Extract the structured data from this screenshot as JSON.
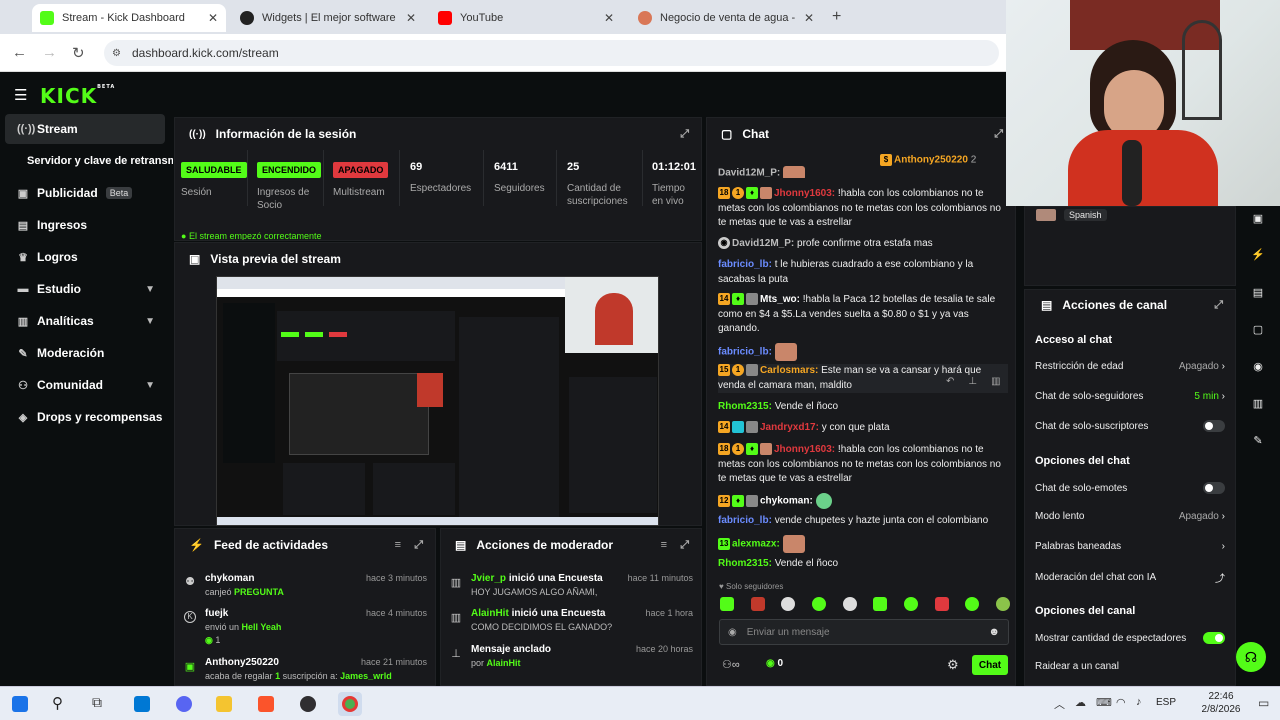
{
  "browser": {
    "tabs": [
      {
        "title": "Stream - Kick Dashboard",
        "active": true
      },
      {
        "title": "Widgets | El mejor software par",
        "active": false
      },
      {
        "title": "YouTube",
        "active": false
      },
      {
        "title": "Negocio de venta de agua - Cla",
        "active": false
      }
    ],
    "url": "dashboard.kick.com/stream"
  },
  "logo": "KICK",
  "logo_beta": "BETA",
  "sidebar": {
    "items": [
      {
        "label": "Stream",
        "icon": "broadcast-icon"
      },
      {
        "label": "Servidor y clave de retransm"
      },
      {
        "label": "Publicidad",
        "badge": "Beta",
        "icon": "ad-icon"
      },
      {
        "label": "Ingresos",
        "icon": "chart-icon"
      },
      {
        "label": "Logros",
        "icon": "trophy-icon"
      },
      {
        "label": "Estudio",
        "icon": "studio-icon"
      },
      {
        "label": "Analíticas",
        "icon": "analytics-icon"
      },
      {
        "label": "Moderación",
        "icon": "wrench-icon"
      },
      {
        "label": "Comunidad",
        "icon": "community-icon"
      },
      {
        "label": "Drops y recompensas",
        "icon": "gift-icon"
      }
    ]
  },
  "session": {
    "title": "Información de la sesión",
    "stats": [
      {
        "badge": "SALUDABLE",
        "label": "Sesión"
      },
      {
        "badge": "ENCENDIDO",
        "label": "Ingresos de Socio"
      },
      {
        "badge": "APAGADO",
        "label": "Multistream"
      },
      {
        "value": "69",
        "label": "Espectadores"
      },
      {
        "value": "6411",
        "label": "Seguidores"
      },
      {
        "value": "25",
        "label": "Cantidad de suscripciones"
      },
      {
        "value": "01:12:01",
        "label": "Tiempo en vivo"
      }
    ],
    "status_line": "El stream empezó correctamente"
  },
  "preview": {
    "title": "Vista previa del stream"
  },
  "feed": {
    "title": "Feed de actividades",
    "items": [
      {
        "user": "chykoman",
        "text": "canjeó",
        "highlight": "PREGUNTA",
        "time": "hace 3 minutos"
      },
      {
        "user": "fuejk",
        "text": "envió un",
        "highlight": "Hell Yeah",
        "extra": "1",
        "time": "hace 4 minutos"
      },
      {
        "user": "Anthony250220",
        "text": "acaba de regalar",
        "count": "1",
        "text2": "suscripción a:",
        "highlight": "James_wrld",
        "time": "hace 21 minutos"
      }
    ]
  },
  "modactions": {
    "title": "Acciones de moderador",
    "items": [
      {
        "user": "Jvier_p",
        "text": "inició una Encuesta",
        "sub": "HOY JUGAMOS ALGO AÑAMI,",
        "time": "hace 11 minutos"
      },
      {
        "user": "AlainHit",
        "text": "inició una Encuesta",
        "sub": "COMO DECIDIMOS EL GANADO?",
        "time": "hace 1 hora"
      },
      {
        "user": "Mensaje anclado",
        "text": "",
        "sub": "por",
        "sub_user": "AlainHit",
        "time": "hace 20 horas"
      }
    ]
  },
  "chat": {
    "title": "Chat",
    "pinned_user": "Anthony250220",
    "pinned_count": "2",
    "messages": [
      {
        "user": "David12M_P:",
        "color": "#bbbbbb",
        "text": ""
      },
      {
        "badges": [
          "18",
          "1"
        ],
        "user": "Jhonny1603:",
        "color": "#e0393e",
        "text": "!habla con los colombianos no te metas con los colombianos no te metas con los colombianos no te metas que te vas a estrellar"
      },
      {
        "user": "David12M_P:",
        "color": "#bbbbbb",
        "text": "profe confirme otra estafa mas"
      },
      {
        "user": "fabricio_lb:",
        "color": "#6b8cff",
        "text": "t le hubieras cuadrado a ese colombiano y la sacabas la puta"
      },
      {
        "badges": [
          "14"
        ],
        "user": "Mts_wo:",
        "color": "#ffffff",
        "text": "!habla la Paca 12 botellas de tesalia te sale como en $4 a $5.La vendes suelta a $0.80 o $1 y ya vas ganando."
      },
      {
        "user": "fabricio_lb:",
        "color": "#6b8cff",
        "text": ""
      },
      {
        "badges": [
          "15",
          "1"
        ],
        "user": "Carlosmars:",
        "color": "#f5a623",
        "text": "Este man se va a cansar y hará que venda el camara man, maldito"
      },
      {
        "user": "Rhom2315:",
        "color": "#53fc18",
        "text": "Vende el ñoco"
      },
      {
        "badges": [
          "14"
        ],
        "user": "Jandryxd17:",
        "color": "#e0393e",
        "text": "y con que plata"
      },
      {
        "badges": [
          "18",
          "1"
        ],
        "user": "Jhonny1603:",
        "color": "#e0393e",
        "text": "!habla con los colombianos no te metas con los colombianos no te metas con los colombianos no te metas que te vas a estrellar"
      },
      {
        "badges": [
          "12"
        ],
        "user": "chykoman:",
        "color": "#ffffff",
        "text": ""
      },
      {
        "user": "fabricio_lb:",
        "color": "#6b8cff",
        "text": "vende chupetes y hazte junta con el colombiano"
      },
      {
        "badges": [
          "13"
        ],
        "user": "alexmazx:",
        "color": "#53fc18",
        "text": ""
      },
      {
        "user": "Rhom2315:",
        "color": "#53fc18",
        "text": "Vende el ñoco"
      }
    ],
    "followers_only": "Solo seguidores",
    "input_placeholder": "Enviar un mensaje",
    "points": "0",
    "send_label": "Chat"
  },
  "channel": {
    "language": "Spanish",
    "title": "Acciones de canal",
    "sections": [
      {
        "heading": "Acceso al chat",
        "rows": [
          {
            "label": "Restricción de edad",
            "value": "Apagado",
            "kind": "arrow"
          },
          {
            "label": "Chat de solo-seguidores",
            "value": "5 min",
            "kind": "arrow",
            "accent": true
          },
          {
            "label": "Chat de solo-suscriptores",
            "kind": "toggle",
            "on": false
          }
        ]
      },
      {
        "heading": "Opciones del chat",
        "rows": [
          {
            "label": "Chat de solo-emotes",
            "kind": "toggle",
            "on": false
          },
          {
            "label": "Modo lento",
            "value": "Apagado",
            "kind": "arrow"
          },
          {
            "label": "Palabras baneadas",
            "kind": "arrow"
          },
          {
            "label": "Moderación del chat con IA",
            "kind": "ext"
          }
        ]
      },
      {
        "heading": "Opciones del canal",
        "rows": [
          {
            "label": "Mostrar cantidad de espectadores",
            "kind": "toggle",
            "on": true
          },
          {
            "label": "Raidear a un canal",
            "kind": "none"
          }
        ]
      }
    ]
  },
  "taskbar": {
    "lang": "ESP",
    "time": "22:46",
    "date": "2/8/2026"
  },
  "colors": {
    "accent": "#53fc18",
    "bg": "#0b0e0f",
    "panel": "#18191c",
    "danger": "#e0393e"
  }
}
